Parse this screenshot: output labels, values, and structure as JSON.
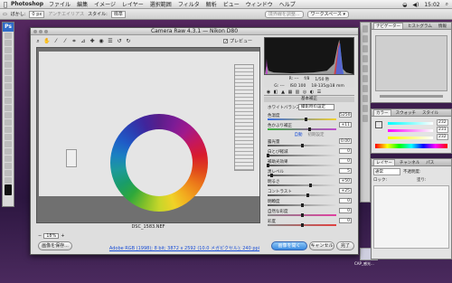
{
  "menubar": {
    "app": "Photoshop",
    "items": [
      "ファイル",
      "編集",
      "イメージ",
      "レイヤー",
      "選択範囲",
      "フィルタ",
      "解析",
      "ビュー",
      "ウィンドウ",
      "ヘルプ"
    ],
    "clock": "15:02"
  },
  "optbar": {
    "feather_label": "ぼかし:",
    "feather_value": "0 px",
    "antialias": "アンチエイリアス",
    "style_label": "スタイル:",
    "style_value": "標準",
    "refine": "境界線を調整...",
    "workspace": "ワークスペース ▾"
  },
  "dialog": {
    "title": "Camera Raw 4.3.1 — Nikon D80",
    "preview_label": "プレビュー",
    "filename": "DSC_1583.NEF",
    "zoom": "18%",
    "status_link": "Adobe RGB (1998); 8 bit; 3872 x 2592 (10.0 メガピクセル); 240 ppi",
    "save_button": "画像を保存...",
    "open_button": "画像を開く",
    "cancel_button": "キャンセル",
    "done_button": "完了"
  },
  "camera_info": {
    "aperture": "f/8",
    "shutter": "1/50 秒",
    "iso": "ISO 100",
    "lens": "18-135@18 mm",
    "r": "R: ---",
    "g": "G: ---",
    "b": "B: ---"
  },
  "basic": {
    "heading": "基本補正",
    "wb_label": "ホワイトバランス:",
    "wb_value": "撮影時の設定",
    "auto": "自動",
    "default": "初期設定",
    "controls": [
      {
        "label": "色温度",
        "value": "5250",
        "pos": 0.55
      },
      {
        "label": "色かぶり補正",
        "value": "+11",
        "pos": 0.6
      },
      {
        "label": "露光量",
        "value": "0.00",
        "pos": 0.5
      },
      {
        "label": "白とび軽減",
        "value": "0",
        "pos": 0.0
      },
      {
        "label": "補助光効果",
        "value": "0",
        "pos": 0.0
      },
      {
        "label": "黒レベル",
        "value": "5",
        "pos": 0.05
      },
      {
        "label": "明るさ",
        "value": "+50",
        "pos": 0.62
      },
      {
        "label": "コントラスト",
        "value": "+25",
        "pos": 0.58
      },
      {
        "label": "明瞭度",
        "value": "0",
        "pos": 0.5
      },
      {
        "label": "自然な彩度",
        "value": "0",
        "pos": 0.5
      },
      {
        "label": "彩度",
        "value": "0",
        "pos": 0.5
      }
    ]
  },
  "panels": {
    "nav_tabs": [
      "ナビゲーター",
      "ヒストグラム",
      "情報"
    ],
    "color_tabs": [
      "カラー",
      "スウォッチ",
      "スタイル"
    ],
    "color_values": {
      "r": "232",
      "g": "231",
      "b": "232"
    },
    "layer_tabs": [
      "レイヤー",
      "チャンネル",
      "パス"
    ],
    "layer_mode": "通常",
    "layer_opacity_label": "不透明度:",
    "layer_lock_label": "ロック:",
    "layer_fill_label": "塗り:"
  },
  "desktop": {
    "icon_label": "CAP_感光..."
  },
  "colors": {
    "accent": "#3a8ae0",
    "link": "#1b4fd6"
  }
}
